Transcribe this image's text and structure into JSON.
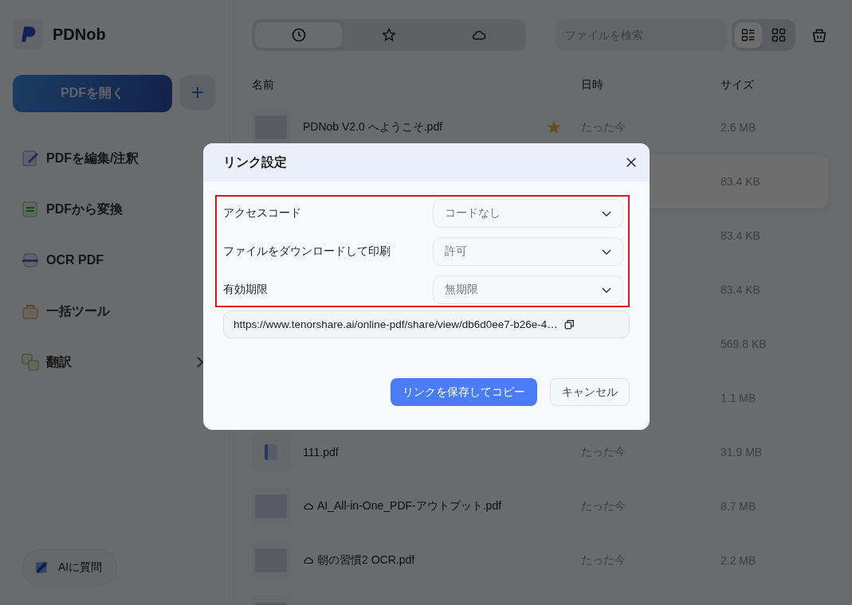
{
  "app": {
    "name": "PDNob"
  },
  "sidebar": {
    "open_button": "PDFを開く",
    "add_button": "+",
    "items": [
      {
        "label": "PDFを編集/注釈",
        "kind": "edit",
        "has_submenu": false
      },
      {
        "label": "PDFから変換",
        "kind": "convert",
        "has_submenu": false
      },
      {
        "label": "OCR PDF",
        "kind": "ocr",
        "has_submenu": false
      },
      {
        "label": "一括ツール",
        "kind": "batch",
        "has_submenu": false
      },
      {
        "label": "翻訳",
        "kind": "translate",
        "has_submenu": true
      }
    ],
    "ai_button": "AIに質問"
  },
  "toolbar": {
    "tabs": [
      {
        "kind": "recent",
        "selected": true
      },
      {
        "kind": "starred",
        "selected": false
      },
      {
        "kind": "cloud",
        "selected": false
      }
    ],
    "search": {
      "placeholder": "ファイルを検索"
    },
    "views": [
      {
        "kind": "list",
        "selected": true
      },
      {
        "kind": "grid",
        "selected": false
      }
    ]
  },
  "table": {
    "columns": [
      "名前",
      "日時",
      "サイズ"
    ],
    "rows": [
      {
        "kind": "preview",
        "name": "PDNob V2.0 へようこそ.pdf",
        "starred": true,
        "cloud": false,
        "date": "たった今",
        "size": "2.6 MB",
        "selected": false
      },
      {
        "size": "83.4 KB",
        "selected": true
      },
      {
        "size": "83.4 KB",
        "selected": false
      },
      {
        "size": "83.4 KB",
        "selected": false
      },
      {
        "size": "569.8 KB",
        "selected": false
      },
      {
        "size": "1.1 MB",
        "selected": false
      },
      {
        "kind": "file",
        "name": "111.pdf",
        "starred": false,
        "cloud": false,
        "date": "たった今",
        "size": "31.9 MB",
        "selected": false
      },
      {
        "kind": "preview",
        "name": "AI_All-in-One_PDF-アウトプット.pdf",
        "starred": false,
        "cloud": true,
        "date": "たった今",
        "size": "8.7 MB",
        "selected": false
      },
      {
        "kind": "preview",
        "name": "朝の習慣2 OCR.pdf",
        "starred": false,
        "cloud": true,
        "date": "たった今",
        "size": "2.2 MB",
        "selected": false
      },
      {
        "kind": "preview",
        "selected": false
      }
    ]
  },
  "dialog": {
    "title": "リンク設定",
    "settings_highlighted": true,
    "settings": [
      {
        "label": "アクセスコード",
        "value": "コードなし"
      },
      {
        "label": "ファイルをダウンロードして印刷",
        "value": "許可"
      },
      {
        "label": "有効期限",
        "value": "無期限"
      }
    ],
    "url": "https://www.tenorshare.ai/online-pdf/share/view/db6d0ee7-b26e-4…",
    "primary_button": "リンクを保存してコピー",
    "cancel_button": "キャンセル"
  }
}
